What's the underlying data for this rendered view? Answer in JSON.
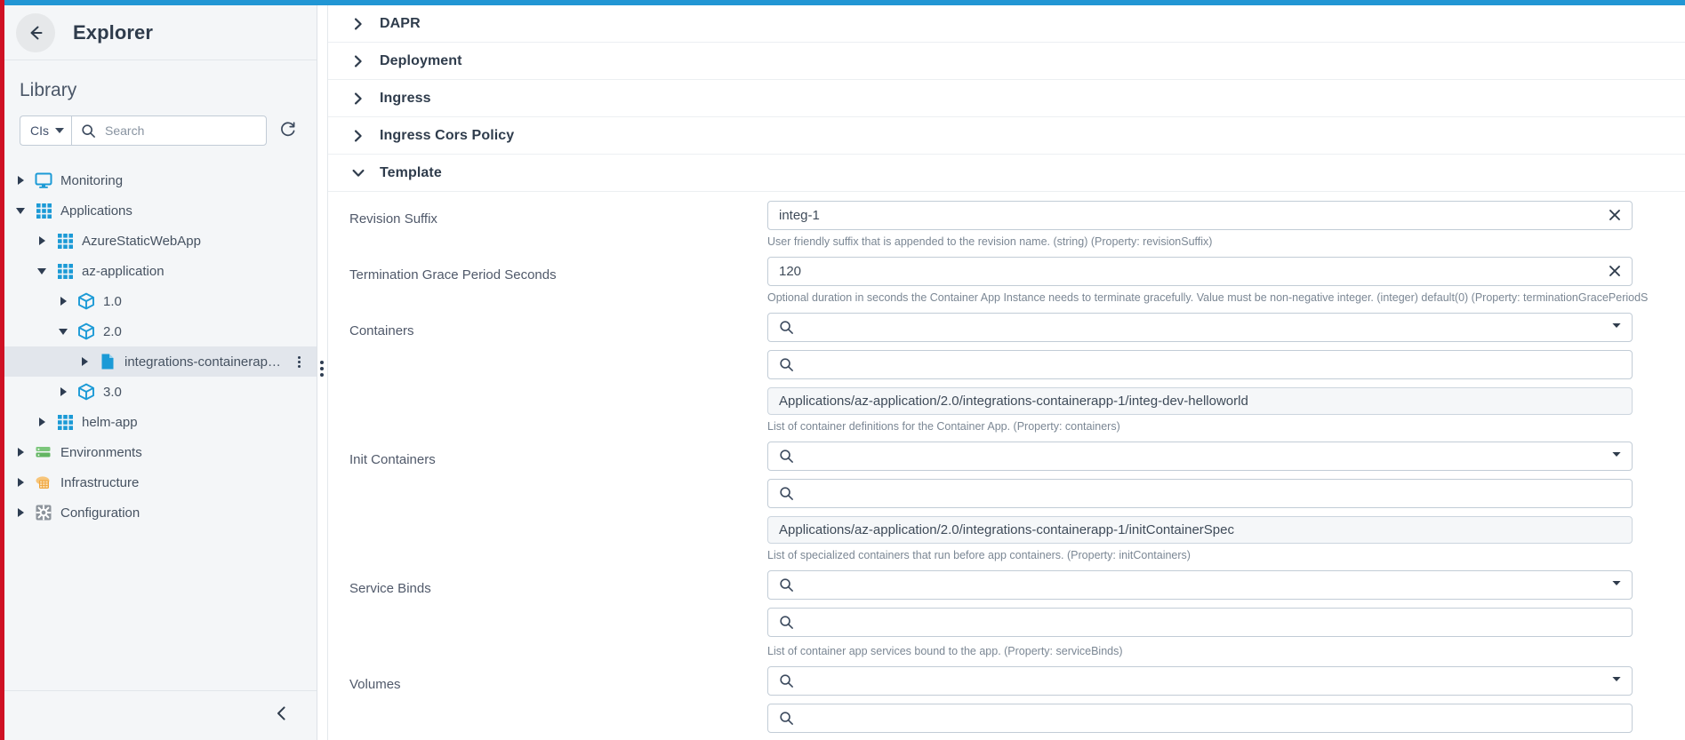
{
  "sidebar": {
    "title": "Explorer",
    "back_icon": "arrow-left-icon",
    "library_label": "Library",
    "search": {
      "scope_label": "CIs",
      "placeholder": "Search",
      "value": "",
      "refresh_icon": "refresh-icon"
    },
    "collapse_icon": "chevron-left-icon",
    "tree": [
      {
        "label": "Monitoring",
        "icon": "monitor-icon",
        "depth": 0,
        "state": "collapsed",
        "selected": false,
        "kebab": false
      },
      {
        "label": "Applications",
        "icon": "grid-icon",
        "depth": 0,
        "state": "expanded",
        "selected": false,
        "kebab": false
      },
      {
        "label": "AzureStaticWebApp",
        "icon": "grid-icon",
        "depth": 1,
        "state": "collapsed",
        "selected": false,
        "kebab": false
      },
      {
        "label": "az-application",
        "icon": "grid-icon",
        "depth": 1,
        "state": "expanded",
        "selected": false,
        "kebab": false
      },
      {
        "label": "1.0",
        "icon": "package-icon",
        "depth": 2,
        "state": "collapsed",
        "selected": false,
        "kebab": false
      },
      {
        "label": "2.0",
        "icon": "package-icon",
        "depth": 2,
        "state": "expanded",
        "selected": false,
        "kebab": false
      },
      {
        "label": "integrations-containerap…",
        "icon": "document-icon",
        "depth": 3,
        "state": "collapsed",
        "selected": true,
        "kebab": true
      },
      {
        "label": "3.0",
        "icon": "package-icon",
        "depth": 2,
        "state": "collapsed",
        "selected": false,
        "kebab": false
      },
      {
        "label": "helm-app",
        "icon": "grid-icon",
        "depth": 1,
        "state": "collapsed",
        "selected": false,
        "kebab": false
      },
      {
        "label": "Environments",
        "icon": "server-icon",
        "depth": 0,
        "state": "collapsed",
        "selected": false,
        "kebab": false
      },
      {
        "label": "Infrastructure",
        "icon": "cloud-grid-icon",
        "depth": 0,
        "state": "collapsed",
        "selected": false,
        "kebab": false
      },
      {
        "label": "Configuration",
        "icon": "gear-icon",
        "depth": 0,
        "state": "collapsed",
        "selected": false,
        "kebab": false
      }
    ]
  },
  "main": {
    "sections": [
      {
        "title": "DAPR",
        "state": "collapsed"
      },
      {
        "title": "Deployment",
        "state": "collapsed"
      },
      {
        "title": "Ingress",
        "state": "collapsed"
      },
      {
        "title": "Ingress Cors Policy",
        "state": "collapsed"
      },
      {
        "title": "Template",
        "state": "expanded"
      }
    ],
    "fields": [
      {
        "label": "Revision Suffix",
        "type": "text",
        "value": "integ-1",
        "clear_icon": "close-icon",
        "help": "User friendly suffix that is appended to the revision name. (string) (Property: revisionSuffix)"
      },
      {
        "label": "Termination Grace Period Seconds",
        "type": "text",
        "value": "120",
        "clear_icon": "close-icon",
        "help": "Optional duration in seconds the Container App Instance needs to terminate gracefully. Value must be non-negative integer. (integer) default(0) (Property: terminationGracePeriodS"
      },
      {
        "label": "Containers",
        "type": "multiselect",
        "search_icon": "search-icon",
        "dropdown_icon": "caret-down-icon",
        "filter_value": "",
        "search_value": "",
        "chips": [
          "Applications/az-application/2.0/integrations-containerapp-1/integ-dev-helloworld"
        ],
        "help": "List of container definitions for the Container App. (Property: containers)"
      },
      {
        "label": "Init Containers",
        "type": "multiselect",
        "search_icon": "search-icon",
        "dropdown_icon": "caret-down-icon",
        "filter_value": "",
        "search_value": "",
        "chips": [
          "Applications/az-application/2.0/integrations-containerapp-1/initContainerSpec"
        ],
        "help": "List of specialized containers that run before app containers. (Property: initContainers)"
      },
      {
        "label": "Service Binds",
        "type": "multiselect",
        "search_icon": "search-icon",
        "dropdown_icon": "caret-down-icon",
        "filter_value": "",
        "search_value": "",
        "chips": [],
        "help": "List of container app services bound to the app. (Property: serviceBinds)"
      },
      {
        "label": "Volumes",
        "type": "multiselect",
        "search_icon": "search-icon",
        "dropdown_icon": "caret-down-icon",
        "filter_value": "",
        "search_value": "",
        "chips": [],
        "help": ""
      }
    ]
  },
  "colors": {
    "accent_top": "#2196d4",
    "accent_left": "#cf1124",
    "icon_blue": "#1b9ad6",
    "text_dark": "#2f3c4c"
  }
}
